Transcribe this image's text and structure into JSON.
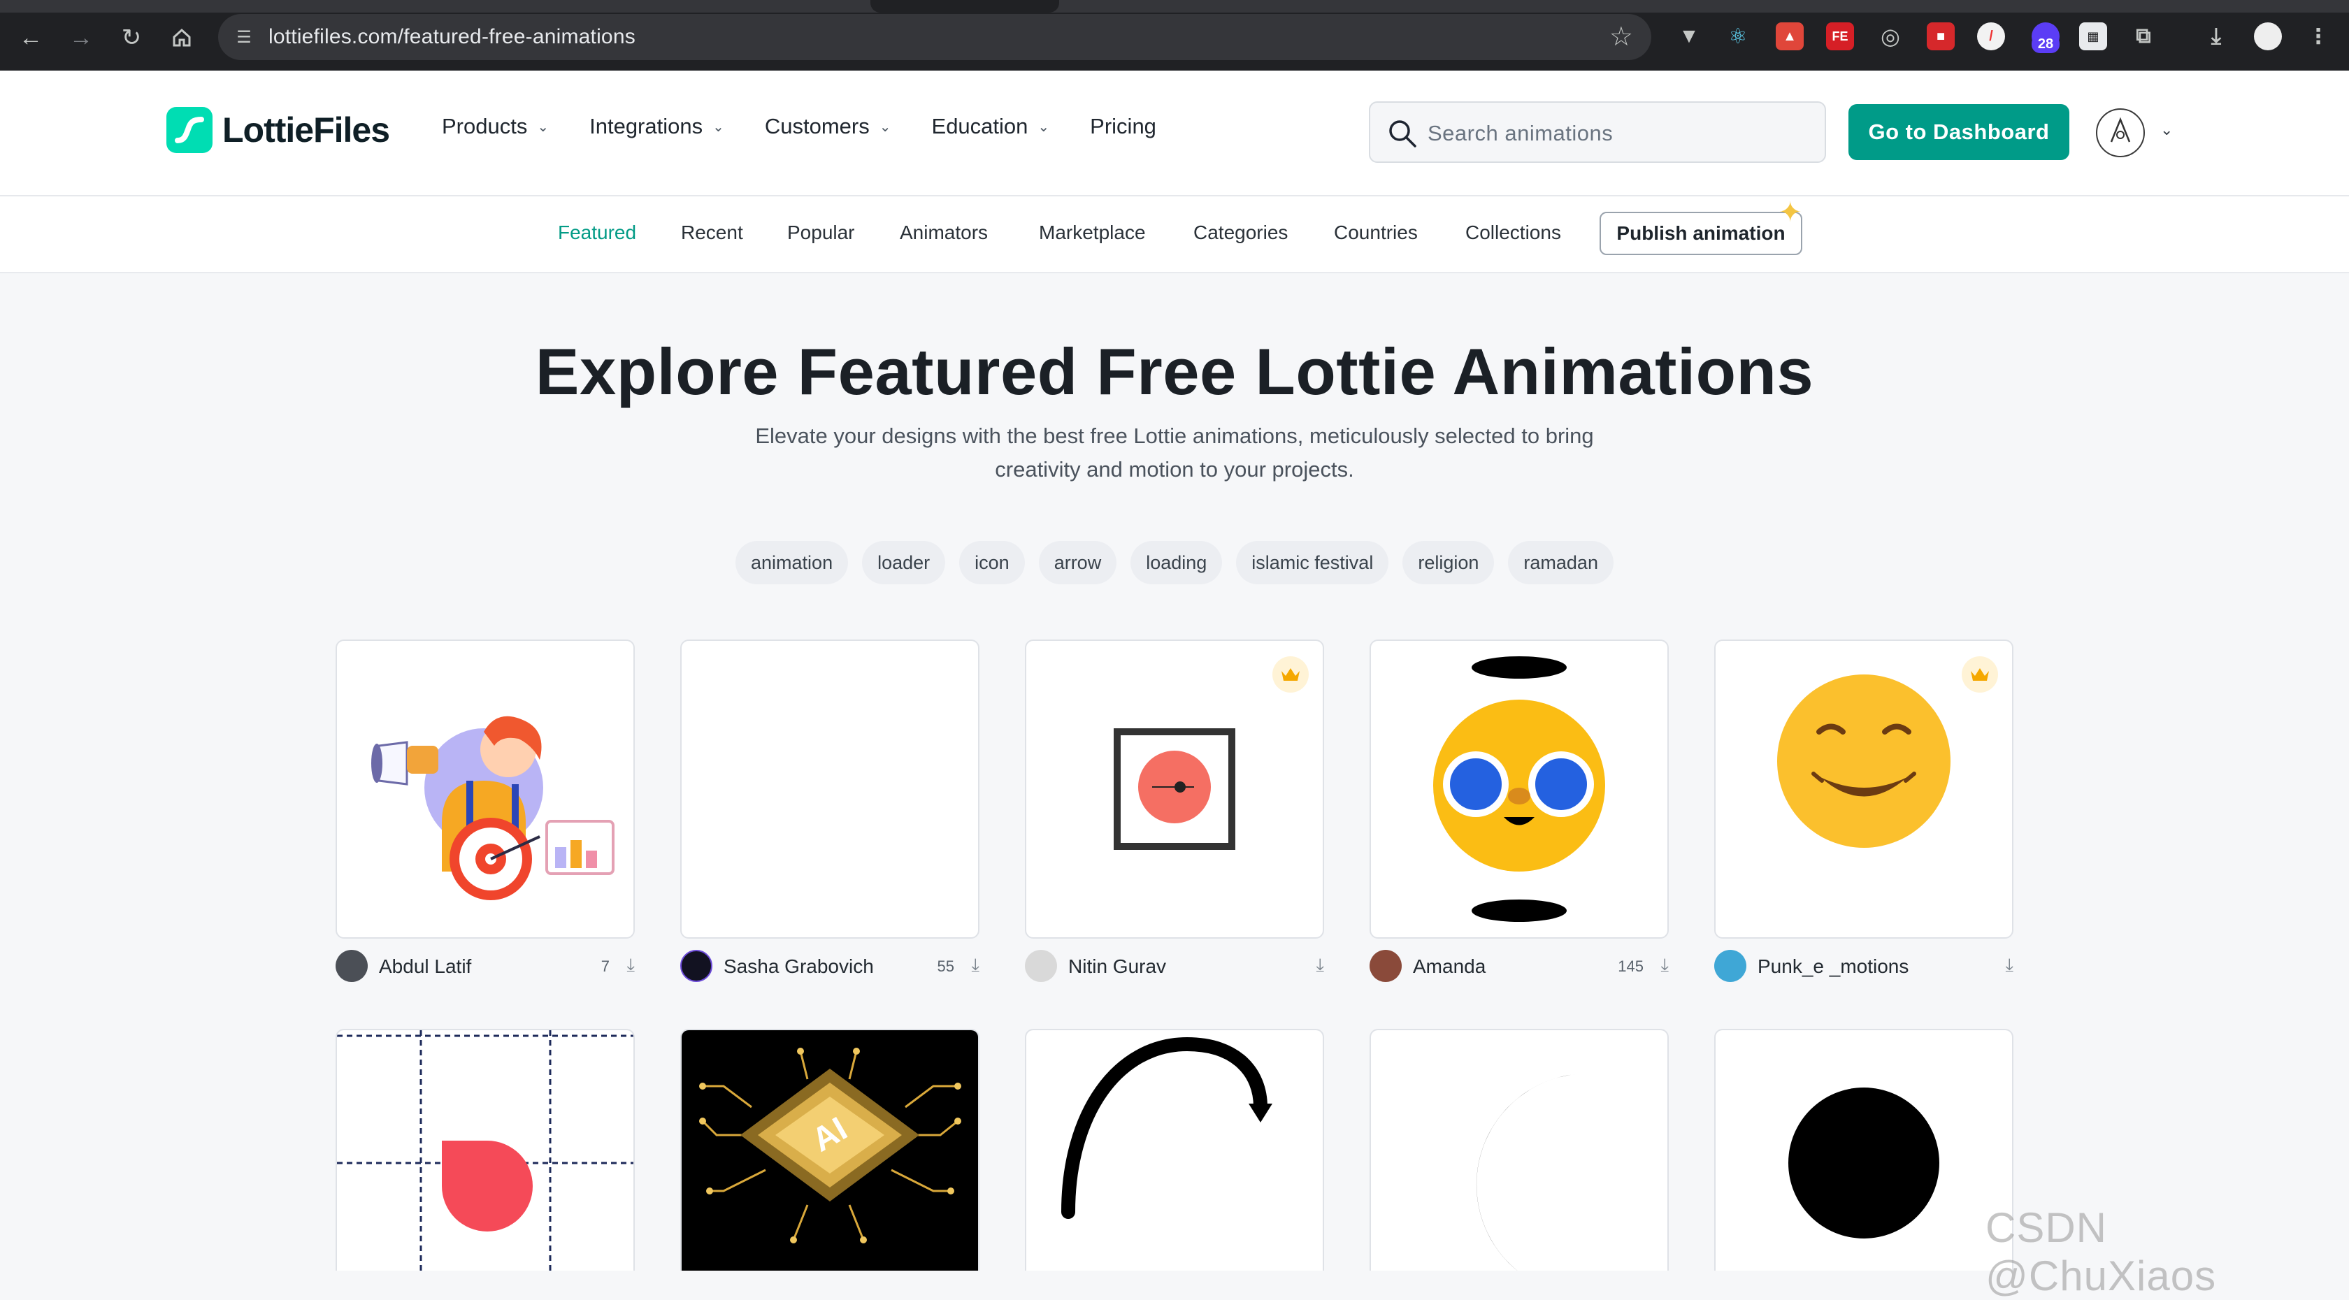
{
  "browser": {
    "url": "lottiefiles.com/featured-free-animations",
    "extension_badge": "28"
  },
  "site": {
    "logo_text": "LottieFiles",
    "nav": [
      {
        "label": "Products",
        "has_dropdown": true
      },
      {
        "label": "Integrations",
        "has_dropdown": true
      },
      {
        "label": "Customers",
        "has_dropdown": true
      },
      {
        "label": "Education",
        "has_dropdown": true
      },
      {
        "label": "Pricing",
        "has_dropdown": false
      }
    ],
    "search_placeholder": "Search animations",
    "dashboard_button": "Go to Dashboard"
  },
  "subnav": {
    "tabs": [
      "Featured",
      "Recent",
      "Popular",
      "Animators",
      "Marketplace",
      "Categories",
      "Countries",
      "Collections"
    ],
    "active": "Featured",
    "publish_button": "Publish animation"
  },
  "hero": {
    "title": "Explore Featured Free Lottie Animations",
    "subtitle_line1": "Elevate your designs with the best free Lottie animations, meticulously selected to bring",
    "subtitle_line2": "creativity and motion to your projects."
  },
  "tags": [
    "animation",
    "loader",
    "icon",
    "arrow",
    "loading",
    "islamic festival",
    "religion",
    "ramadan"
  ],
  "cards_row1": [
    {
      "author": "Abdul Latif",
      "downloads": "7",
      "premium": false
    },
    {
      "author": "Sasha Grabovich",
      "downloads": "55",
      "premium": false
    },
    {
      "author": "Nitin Gurav",
      "downloads": "",
      "premium": true
    },
    {
      "author": "Amanda",
      "downloads": "145",
      "premium": false
    },
    {
      "author": "Punk_e _motions",
      "downloads": "",
      "premium": true
    }
  ],
  "cards_row2_art": [
    "red-petal-grid",
    "ai-chip",
    "curved-arrow",
    "black-crescent",
    "black-circle"
  ],
  "chip_text": "AI",
  "watermark": "CSDN @ChuXiaos",
  "colors": {
    "brand_teal": "#00ddb3",
    "button_teal": "#009b88",
    "active_tab": "#039b86",
    "emoji_yellow": "#fbc02d"
  }
}
